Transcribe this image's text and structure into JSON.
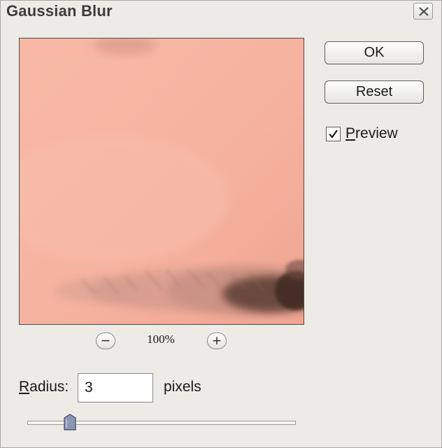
{
  "window": {
    "title": "Gaussian Blur"
  },
  "buttons": {
    "ok_label": "OK",
    "reset_label": "Reset"
  },
  "preview_option": {
    "label": "Preview",
    "checked": true
  },
  "zoom": {
    "level": "100%",
    "zoom_out_icon": "minus-icon",
    "zoom_in_icon": "plus-icon"
  },
  "radius": {
    "label": "Radius:",
    "value": "3",
    "unit": "pixels",
    "slider_fraction": 0.16
  },
  "colors": {
    "dialog_bg": "#ecebe6",
    "skin": "#f5b3a0",
    "brow": "#5a3c33"
  }
}
